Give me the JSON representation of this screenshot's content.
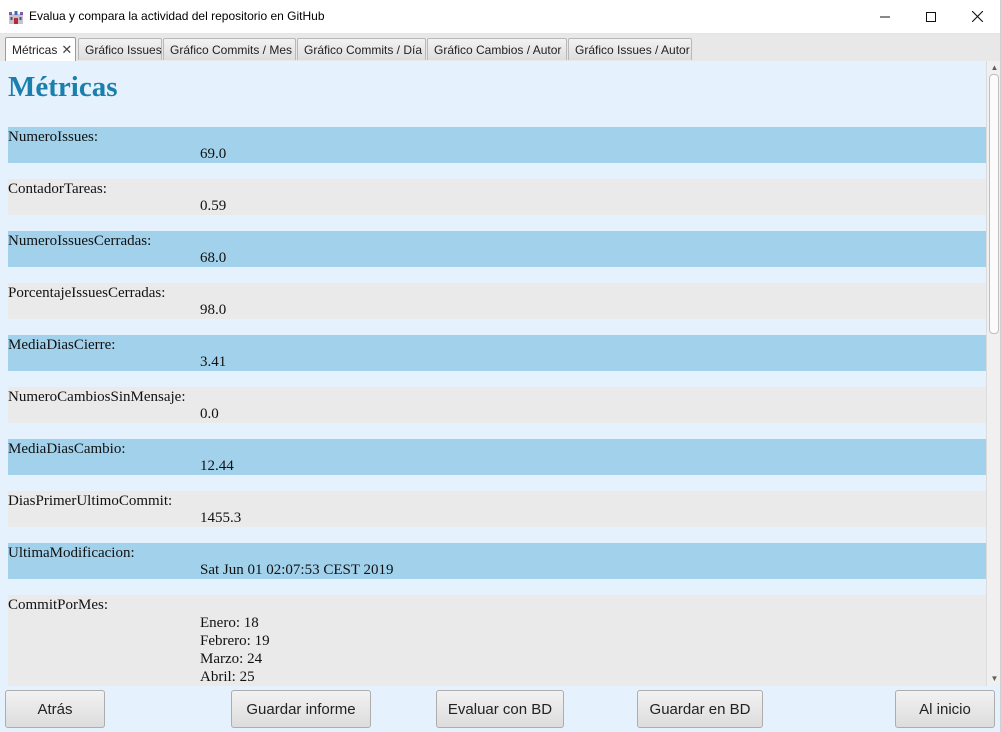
{
  "window": {
    "title": "Evalua y compara la actividad del repositorio en GitHub",
    "icon": "castle-app-icon"
  },
  "tabs": [
    {
      "label": "Métricas",
      "closable": true,
      "active": true
    },
    {
      "label": "Gráfico Issues"
    },
    {
      "label": "Gráfico Commits / Mes"
    },
    {
      "label": "Gráfico Commits / Día"
    },
    {
      "label": "Gráfico Cambios / Autor"
    },
    {
      "label": "Gráfico Issues / Autor"
    }
  ],
  "tab_close_glyph": "✕",
  "page": {
    "heading": "Métricas",
    "metrics": [
      {
        "label": "NumeroIssues:",
        "value": "69.0"
      },
      {
        "label": "ContadorTareas:",
        "value": "0.59"
      },
      {
        "label": "NumeroIssuesCerradas:",
        "value": "68.0"
      },
      {
        "label": "PorcentajeIssuesCerradas:",
        "value": "98.0"
      },
      {
        "label": "MediaDiasCierre:",
        "value": "3.41"
      },
      {
        "label": "NumeroCambiosSinMensaje:",
        "value": "0.0"
      },
      {
        "label": "MediaDiasCambio:",
        "value": "12.44"
      },
      {
        "label": "DiasPrimerUltimoCommit:",
        "value": "1455.3"
      },
      {
        "label": "UltimaModificacion:",
        "value": "Sat Jun 01 02:07:53 CEST 2019"
      }
    ],
    "commit_por_mes": {
      "label": "CommitPorMes:",
      "values": [
        "Enero: 18",
        "Febrero: 19",
        "Marzo: 24",
        "Abril: 25"
      ]
    }
  },
  "buttons": {
    "atras": "Atrás",
    "guardar_informe": "Guardar informe",
    "evaluar_bd": "Evaluar con BD",
    "guardar_bd": "Guardar en BD",
    "al_inicio": "Al inicio"
  },
  "colors": {
    "heading": "#1a7fae",
    "row_blue": "#a2d1eb",
    "row_gray": "#eaeaea",
    "background": "#e5f1fd"
  }
}
